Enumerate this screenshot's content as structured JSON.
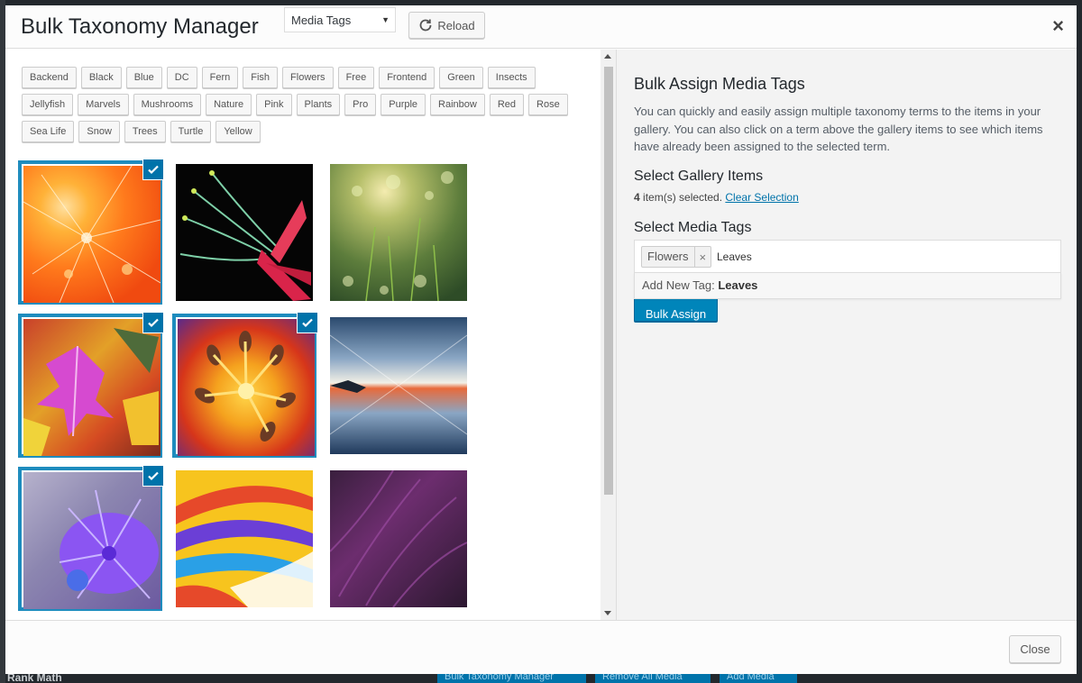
{
  "backdrop": {
    "sidebar_text": "Rank Math",
    "buttons": [
      "Bulk Taxonomy Manager",
      "Remove All Media",
      "Add Media"
    ]
  },
  "header": {
    "title": "Bulk Taxonomy Manager",
    "taxonomy_select": "Media Tags",
    "reload_label": "Reload",
    "close_icon": "close-icon"
  },
  "tags": [
    "Backend",
    "Black",
    "Blue",
    "DC",
    "Fern",
    "Fish",
    "Flowers",
    "Free",
    "Frontend",
    "Green",
    "Insects",
    "Jellyfish",
    "Marvels",
    "Mushrooms",
    "Nature",
    "Pink",
    "Plants",
    "Pro",
    "Purple",
    "Rainbow",
    "Red",
    "Rose",
    "Sea Life",
    "Snow",
    "Trees",
    "Turtle",
    "Yellow"
  ],
  "gallery": {
    "items": [
      {
        "name": "dandelion-orange",
        "selected": true
      },
      {
        "name": "flower-stamens-black",
        "selected": false
      },
      {
        "name": "grass-bokeh",
        "selected": false
      },
      {
        "name": "autumn-leaves",
        "selected": true
      },
      {
        "name": "lily-macro",
        "selected": true
      },
      {
        "name": "sky-reflection",
        "selected": false
      },
      {
        "name": "purple-chrysanthemum",
        "selected": true
      },
      {
        "name": "color-swirl",
        "selected": false
      },
      {
        "name": "purple-feathers",
        "selected": false
      }
    ]
  },
  "panel": {
    "title": "Bulk Assign Media Tags",
    "description": "You can quickly and easily assign multiple taxonomy terms to the items in your gallery. You can also click on a term above the gallery items to see which items have already been assigned to the selected term.",
    "gallery_heading": "Select Gallery Items",
    "selected_count": "4",
    "selected_suffix": " item(s) selected.",
    "clear_selection": "Clear Selection",
    "tags_heading": "Select Media Tags",
    "chip_label": "Flowers",
    "chip_remove": "×",
    "input_value": "Leaves",
    "suggest_prefix": "Add New Tag: ",
    "suggest_value": "Leaves",
    "assign_label": "Bulk Assign"
  },
  "footer": {
    "close_label": "Close"
  },
  "colors": {
    "accent": "#0073aa",
    "primary_button": "#0085ba"
  }
}
